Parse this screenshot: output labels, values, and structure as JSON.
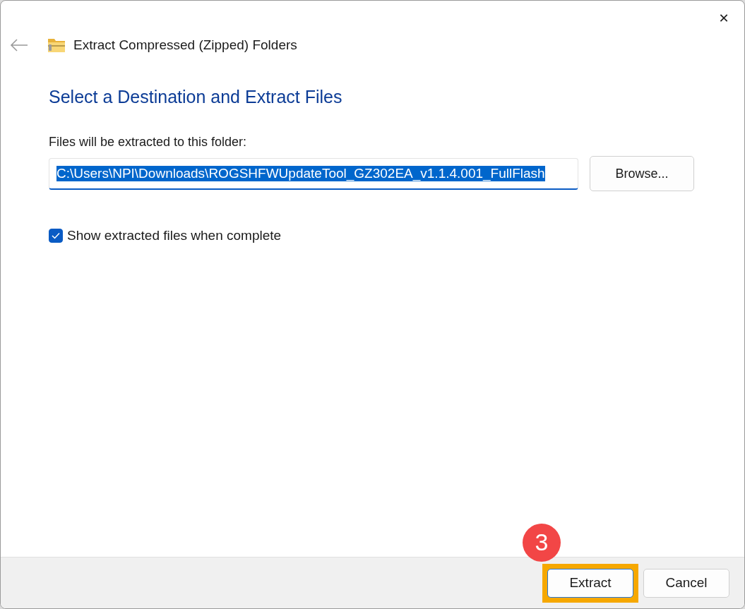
{
  "window": {
    "title": "Extract Compressed (Zipped) Folders",
    "close": "✕"
  },
  "heading": "Select a Destination and Extract Files",
  "destination": {
    "label": "Files will be extracted to this folder:",
    "value": "C:\\Users\\NPI\\Downloads\\ROGSHFWUpdateTool_GZ302EA_v1.1.4.001_FullFlash",
    "value_selected": true,
    "browse": "Browse..."
  },
  "show_files": {
    "label": "Show extracted files when complete",
    "checked": true
  },
  "buttons": [
    {
      "label": "Extract",
      "default": true,
      "highlighted": true,
      "badge": "3"
    },
    {
      "label": "Cancel",
      "default": false,
      "highlighted": false
    }
  ]
}
